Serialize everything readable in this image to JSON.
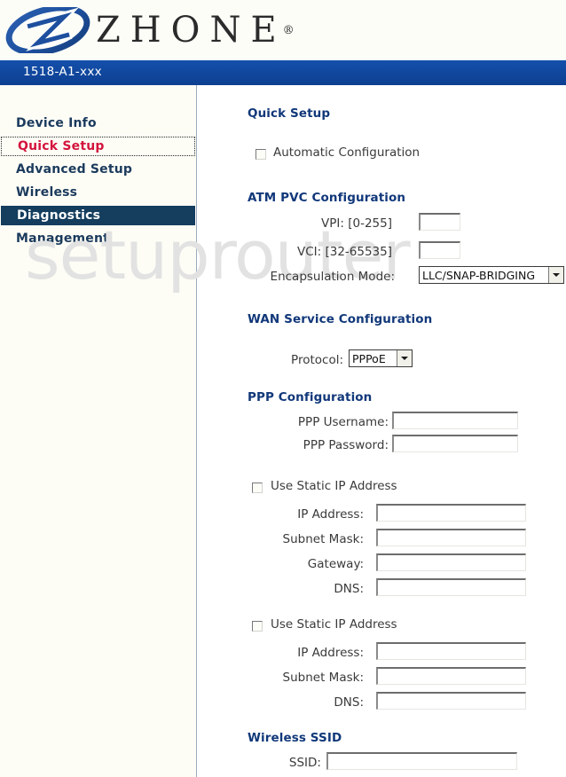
{
  "header": {
    "brand": "ZHONE",
    "registered_mark": "®",
    "logo_icon": "zhone-oval-z-logo"
  },
  "model_banner": {
    "model": "1518-A1-xxx"
  },
  "watermark": {
    "text": "setuprouter"
  },
  "sidebar": {
    "items": [
      {
        "label": "Device Info",
        "state": "normal"
      },
      {
        "label": "Quick Setup",
        "state": "focused"
      },
      {
        "label": "Advanced Setup",
        "state": "normal"
      },
      {
        "label": "Wireless",
        "state": "normal"
      },
      {
        "label": "Diagnostics",
        "state": "selected"
      },
      {
        "label": "Management",
        "state": "normal"
      }
    ]
  },
  "main": {
    "page_title": "Quick Setup",
    "automatic_configuration": {
      "label": "Automatic Configuration",
      "checked": false
    },
    "atm_pvc": {
      "title": "ATM PVC Configuration",
      "vpi_label": "VPI: [0-255]",
      "vpi_value": "",
      "vci_label": "VCI: [32-65535]",
      "vci_value": "",
      "encapsulation_label": "Encapsulation Mode:",
      "encapsulation_value": "LLC/SNAP-BRIDGING"
    },
    "wan_service": {
      "title": "WAN Service Configuration",
      "protocol_label": "Protocol:",
      "protocol_value": "PPPoE"
    },
    "ppp": {
      "title": "PPP Configuration",
      "username_label": "PPP Username:",
      "username_value": "",
      "password_label": "PPP Password:",
      "password_value": ""
    },
    "static_ip_wan": {
      "checkbox_label": "Use Static IP Address",
      "checked": false,
      "ip_label": "IP Address:",
      "ip_value": "",
      "subnet_label": "Subnet Mask:",
      "subnet_value": "",
      "gateway_label": "Gateway:",
      "gateway_value": "",
      "dns_label": "DNS:",
      "dns_value": ""
    },
    "static_ip_lan": {
      "checkbox_label": "Use Static IP Address",
      "checked": false,
      "ip_label": "IP Address:",
      "ip_value": "",
      "subnet_label": "Subnet Mask:",
      "subnet_value": "",
      "dns_label": "DNS:",
      "dns_value": ""
    },
    "wireless": {
      "title": "Wireless SSID",
      "ssid_label": "SSID:",
      "ssid_value": ""
    }
  },
  "colors": {
    "banner_blue": "#0f47a1",
    "heading_blue": "#11387a",
    "nav_text_blue": "#1b3a5c",
    "nav_focused_red": "#d3143c",
    "nav_selected_bg": "#143d5e",
    "watermark_gray": "#e2e2e2"
  }
}
